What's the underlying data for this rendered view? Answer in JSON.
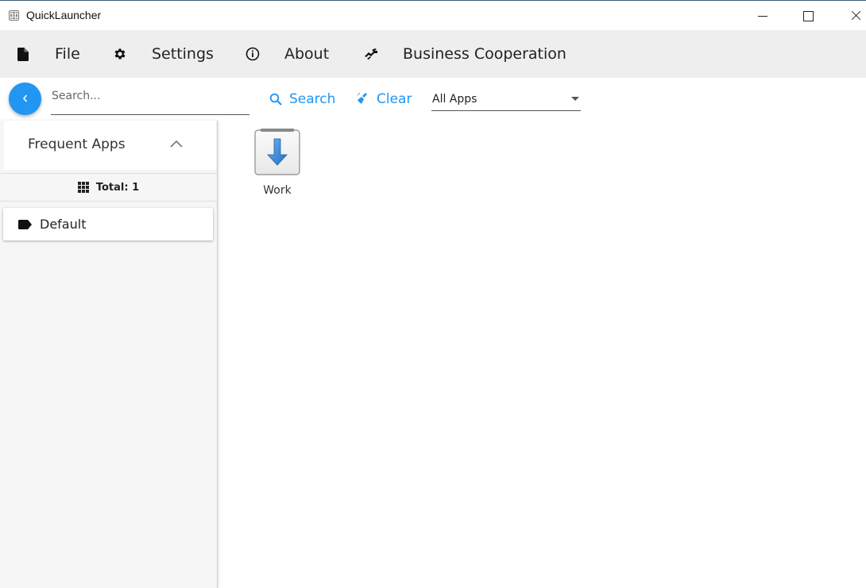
{
  "window": {
    "title": "QuickLauncher",
    "icon": "app-grid-icon"
  },
  "menu": {
    "items": [
      {
        "label": "File",
        "icon": "file-icon"
      },
      {
        "label": "Settings",
        "icon": "gear-icon"
      },
      {
        "label": "About",
        "icon": "info-icon"
      },
      {
        "label": "Business Cooperation",
        "icon": "handshake-icon"
      }
    ]
  },
  "toolbar": {
    "back_icon": "chevron-left-icon",
    "search_placeholder": "Search...",
    "search_value": "",
    "search_label": "Search",
    "clear_label": "Clear",
    "filter_selected": "All Apps",
    "accent_color": "#2196f3"
  },
  "sidebar": {
    "header": "Frequent Apps",
    "total_label": "Total: 1",
    "items": [
      {
        "label": "Default",
        "icon": "tag-icon"
      }
    ]
  },
  "apps": [
    {
      "label": "Work",
      "icon": "download-arrow-icon"
    }
  ]
}
